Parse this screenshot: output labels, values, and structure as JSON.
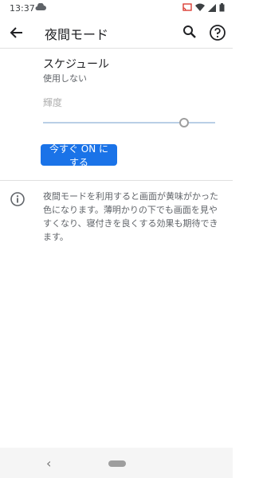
{
  "status_bar": {
    "time": "13:37",
    "icons": [
      "cloud-icon",
      "cast-icon",
      "wifi-icon",
      "signal-icon",
      "battery-icon"
    ]
  },
  "app_bar": {
    "title": "夜間モード",
    "icons": [
      "back-arrow-icon",
      "search-icon",
      "help-icon"
    ]
  },
  "schedule": {
    "title": "スケジュール",
    "summary": "使用しない"
  },
  "brightness": {
    "label": "輝度",
    "level": 0.82
  },
  "turn_on_button": {
    "label": "今すぐ ON にする"
  },
  "info": {
    "text": "夜間モードを利用すると画面が黄味がかった色になります。薄明かりの下でも画面を見やすくなり、寝付きを良くする効果も期待できます。"
  },
  "nav": {
    "back_symbol": "‹"
  },
  "colors": {
    "accent": "#1a73e8",
    "divider": "#e0e0e0",
    "secondary_text": "#5f6368"
  }
}
